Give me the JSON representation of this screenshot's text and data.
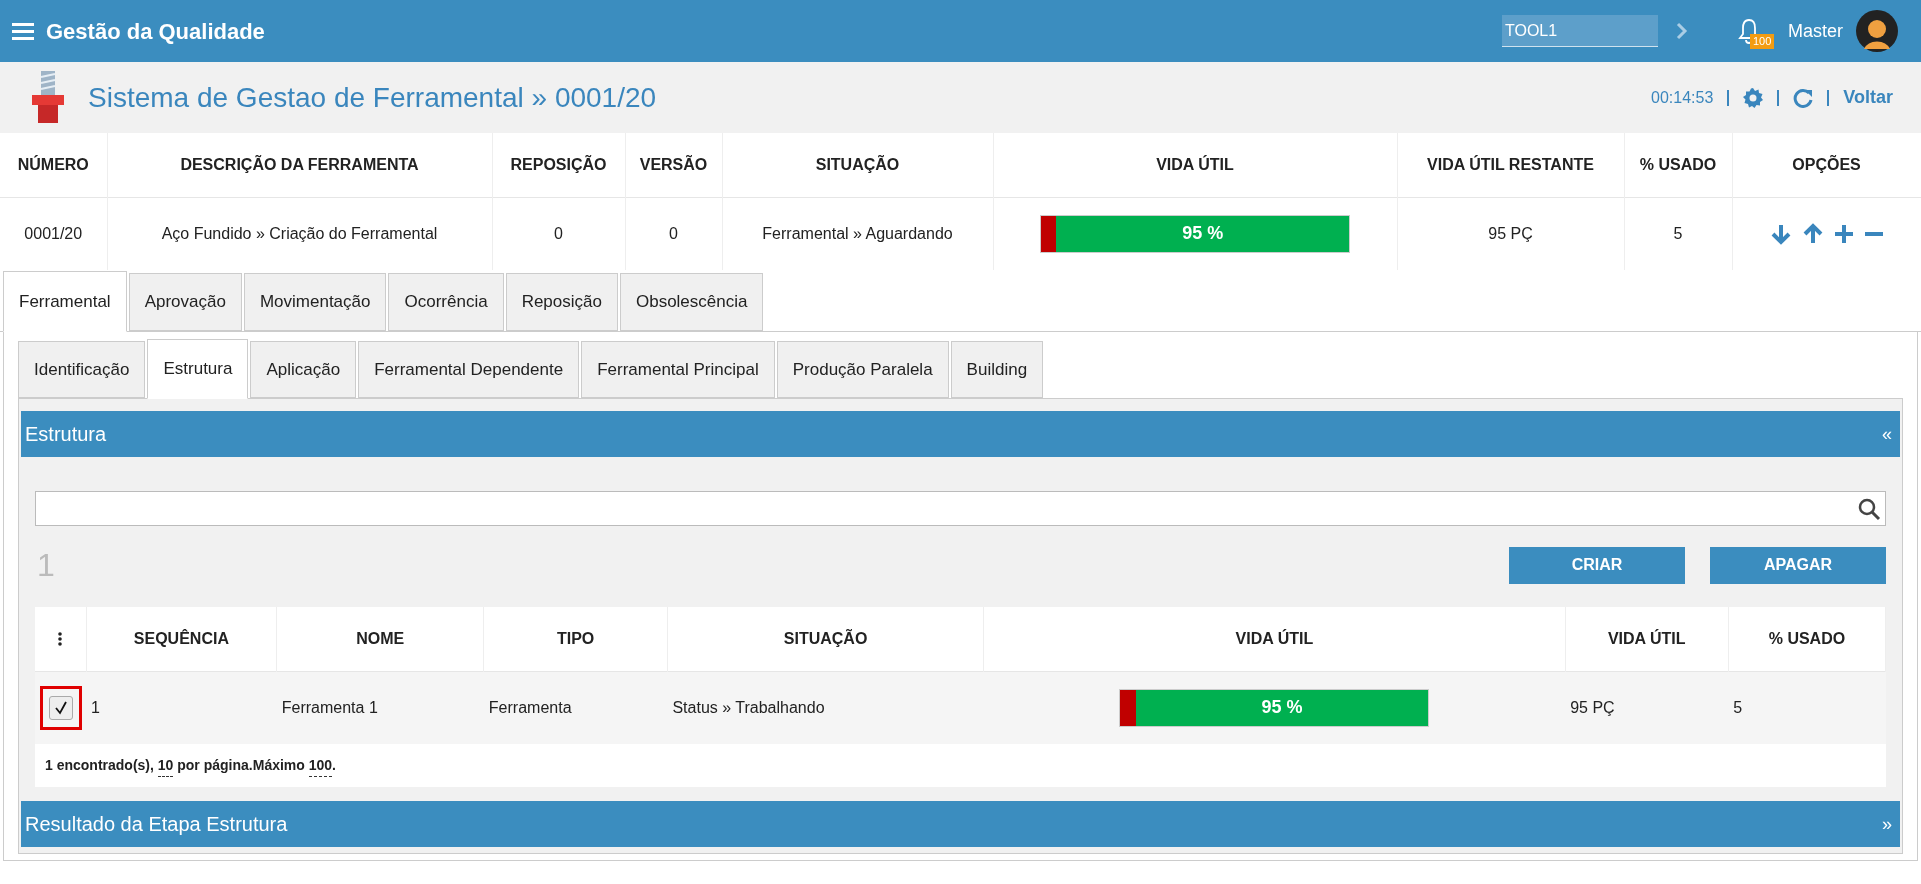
{
  "app_bar": {
    "title": "Gestão da Qualidade",
    "search_value": "TOOL1",
    "notification_count": "100",
    "user": "Master"
  },
  "page_header": {
    "title": "Sistema de Gestao de Ferramental » 0001/20",
    "timer": "00:14:53",
    "back_link": "Voltar"
  },
  "summary_table": {
    "columns": [
      "NÚMERO",
      "DESCRIÇÃO DA FERRAMENTA",
      "REPOSIÇÃO",
      "VERSÃO",
      "SITUAÇÃO",
      "VIDA ÚTIL",
      "VIDA ÚTIL RESTANTE",
      "% USADO",
      "OPÇÕES"
    ],
    "cells": [
      {
        "kind": "text",
        "text": "0001/20"
      },
      {
        "kind": "text",
        "text": "Aço Fundido » Criação do Ferramental"
      },
      {
        "kind": "text",
        "text": "0"
      },
      {
        "kind": "text",
        "text": "0"
      },
      {
        "kind": "text",
        "text": "Ferramental » Aguardando"
      },
      {
        "kind": "bar",
        "level": 0.95,
        "text": "95 %"
      },
      {
        "kind": "text",
        "text": "95 PÇ"
      },
      {
        "kind": "text",
        "text": "5"
      },
      {
        "kind": "actions"
      }
    ]
  },
  "tabs": [
    {
      "label": "Ferramental",
      "selected": true
    },
    {
      "label": "Aprovação",
      "selected": false
    },
    {
      "label": "Movimentação",
      "selected": false
    },
    {
      "label": "Ocorrência",
      "selected": false
    },
    {
      "label": "Reposição",
      "selected": false
    },
    {
      "label": "Obsolescência",
      "selected": false
    }
  ],
  "subtabs": [
    {
      "label": "Identificação",
      "selected": false
    },
    {
      "label": "Estrutura",
      "selected": true
    },
    {
      "label": "Aplicação",
      "selected": false
    },
    {
      "label": "Ferramental Dependente",
      "selected": false
    },
    {
      "label": "Ferramental Principal",
      "selected": false
    },
    {
      "label": "Produção Paralela",
      "selected": false
    },
    {
      "label": "Building",
      "selected": false
    }
  ],
  "structure_panel": {
    "title": "Estrutura",
    "toggle_glyph": "«",
    "count": "1",
    "buttons": [
      "CRIAR",
      "APAGAR"
    ],
    "table": {
      "columns": [
        "SEQUÊNCIA",
        "NOME",
        "TIPO",
        "SITUAÇÃO",
        "VIDA ÚTIL",
        "VIDA ÚTIL",
        "% USADO"
      ],
      "rows": [
        {
          "checked": true,
          "highlighted": true,
          "cells": [
            {
              "kind": "text",
              "text": "1"
            },
            {
              "kind": "text",
              "text": "Ferramenta 1"
            },
            {
              "kind": "text",
              "text": "Ferramenta"
            },
            {
              "kind": "text",
              "text": "Status » Trabalhando"
            },
            {
              "kind": "bar",
              "level": 0.95,
              "text": "95 %"
            },
            {
              "kind": "text",
              "text": "95 PÇ"
            },
            {
              "kind": "text",
              "text": "5"
            }
          ]
        }
      ]
    },
    "footer": {
      "found": "1 encontrado(s),",
      "page_size": "10",
      "per_page": "por página.Máximo",
      "max": "100",
      "end": "."
    }
  },
  "result_panel": {
    "title": "Resultado da Etapa Estrutura",
    "toggle_glyph": "»"
  }
}
